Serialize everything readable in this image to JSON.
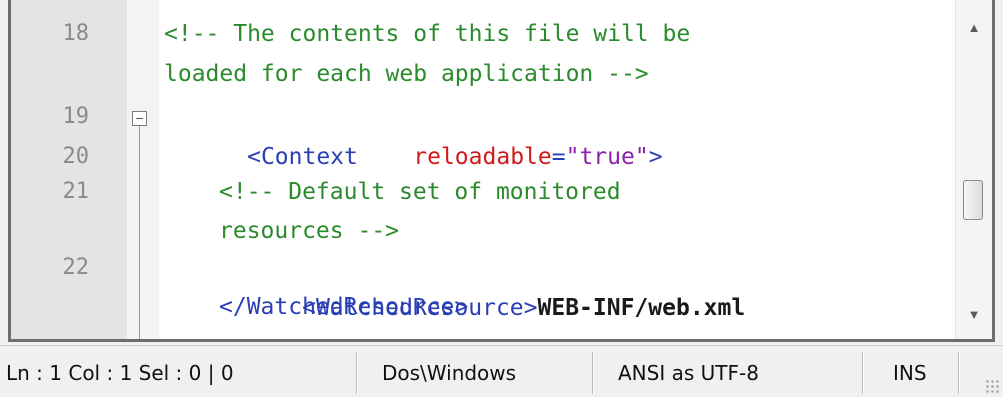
{
  "editor": {
    "line_numbers": [
      "18",
      "19",
      "20",
      "21",
      "22"
    ],
    "lines": {
      "l18a": "<!-- The contents of this file will be",
      "l18b": "loaded for each web application -->",
      "l19_tag": "<Context",
      "l19_attr": "reloadable",
      "l19_eq": "=",
      "l19_val": "\"true\"",
      "l19_close": ">",
      "l21a": "<!-- Default set of monitored",
      "l21b": "resources -->",
      "l22_open": "<WatchedResource>",
      "l22_text": "WEB-INF/web.xml",
      "l22_close": "</WatchedResource>"
    }
  },
  "scrollbar": {
    "up_arrow": "▲",
    "down_arrow": "▼"
  },
  "status_bar": {
    "position": "Ln : 1   Col : 1   Sel : 0 | 0",
    "eol": "Dos\\Windows",
    "encoding": "ANSI as UTF-8",
    "mode": "INS"
  },
  "colors": {
    "comment": "#2b8a2b",
    "tag": "#2a3fb3",
    "attribute": "#d01919",
    "value": "#8a1fb0"
  }
}
